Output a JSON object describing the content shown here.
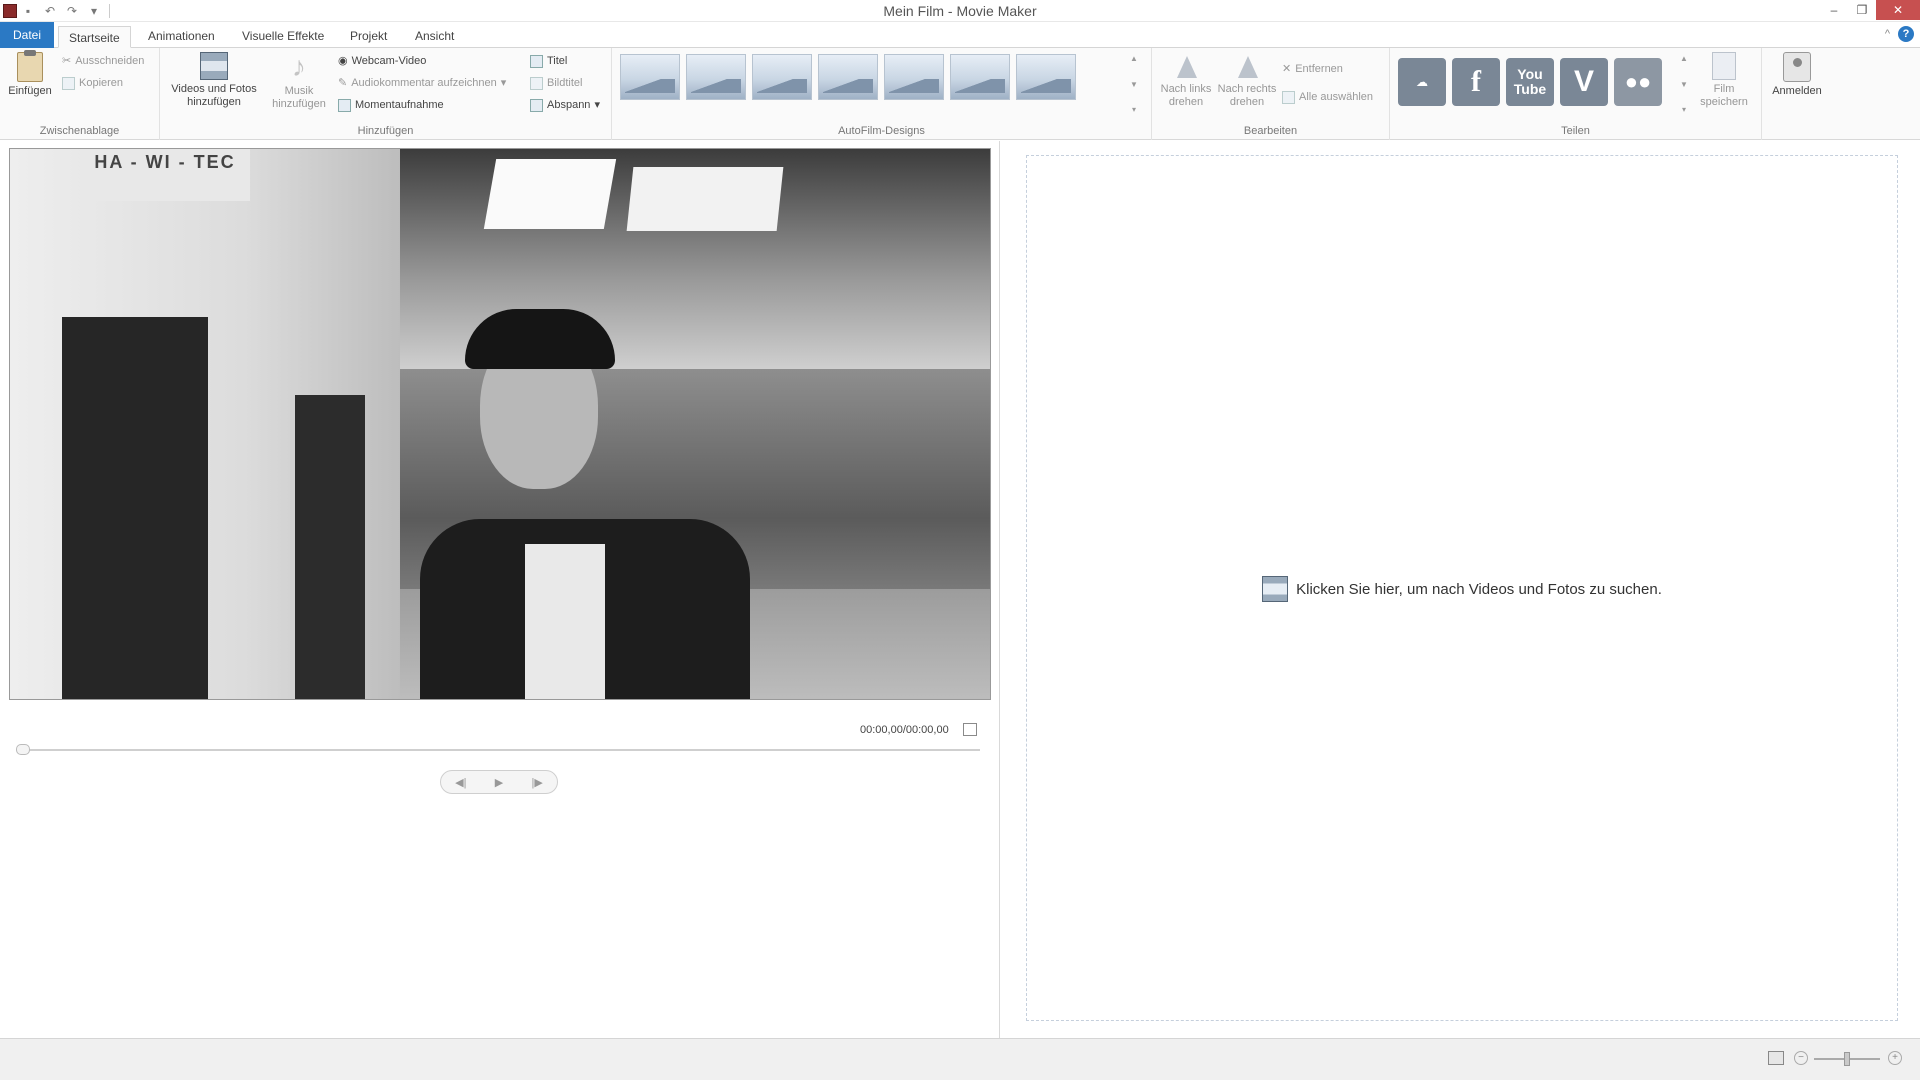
{
  "window": {
    "title": "Mein Film - Movie Maker"
  },
  "tabs": [
    "Datei",
    "Startseite",
    "Animationen",
    "Visuelle Effekte",
    "Projekt",
    "Ansicht"
  ],
  "ribbon": {
    "clipboard": {
      "label": "Zwischenablage",
      "paste": "Einfügen",
      "cut": "Ausschneiden",
      "copy": "Kopieren"
    },
    "add": {
      "label": "Hinzufügen",
      "videos_line1": "Videos und Fotos",
      "videos_line2": "hinzufügen",
      "music_line1": "Musik",
      "music_line2": "hinzufügen",
      "webcam": "Webcam-Video",
      "narration": "Audiokommentar aufzeichnen",
      "snapshot": "Momentaufnahme",
      "title": "Titel",
      "caption": "Bildtitel",
      "credits": "Abspann"
    },
    "themes": {
      "label": "AutoFilm-Designs"
    },
    "edit": {
      "label": "Bearbeiten",
      "rotate_left_line1": "Nach links",
      "rotate_left_line2": "drehen",
      "rotate_right_line1": "Nach rechts",
      "rotate_right_line2": "drehen",
      "remove": "Entfernen",
      "select_all": "Alle auswählen"
    },
    "share": {
      "label": "Teilen",
      "youtube_top": "You",
      "youtube_bottom": "Tube",
      "facebook": "f",
      "vimeo": "V",
      "save_line1": "Film",
      "save_line2": "speichern"
    },
    "signin": {
      "label": "Anmelden"
    }
  },
  "preview": {
    "sign_line1": "HA - WI - TEC",
    "time": "00:00,00/00:00,00"
  },
  "storyboard": {
    "hint": "Klicken Sie hier, um nach Videos und Fotos zu suchen."
  },
  "colors": {
    "accent": "#2b79c4",
    "close": "#c75050",
    "youtube": "#7a8796",
    "facebook": "#7a8796"
  },
  "icons": {
    "cloud": "cloud-icon",
    "facebook": "facebook-icon",
    "youtube": "youtube-icon",
    "vimeo": "vimeo-icon",
    "flickr": "flickr-icon"
  }
}
